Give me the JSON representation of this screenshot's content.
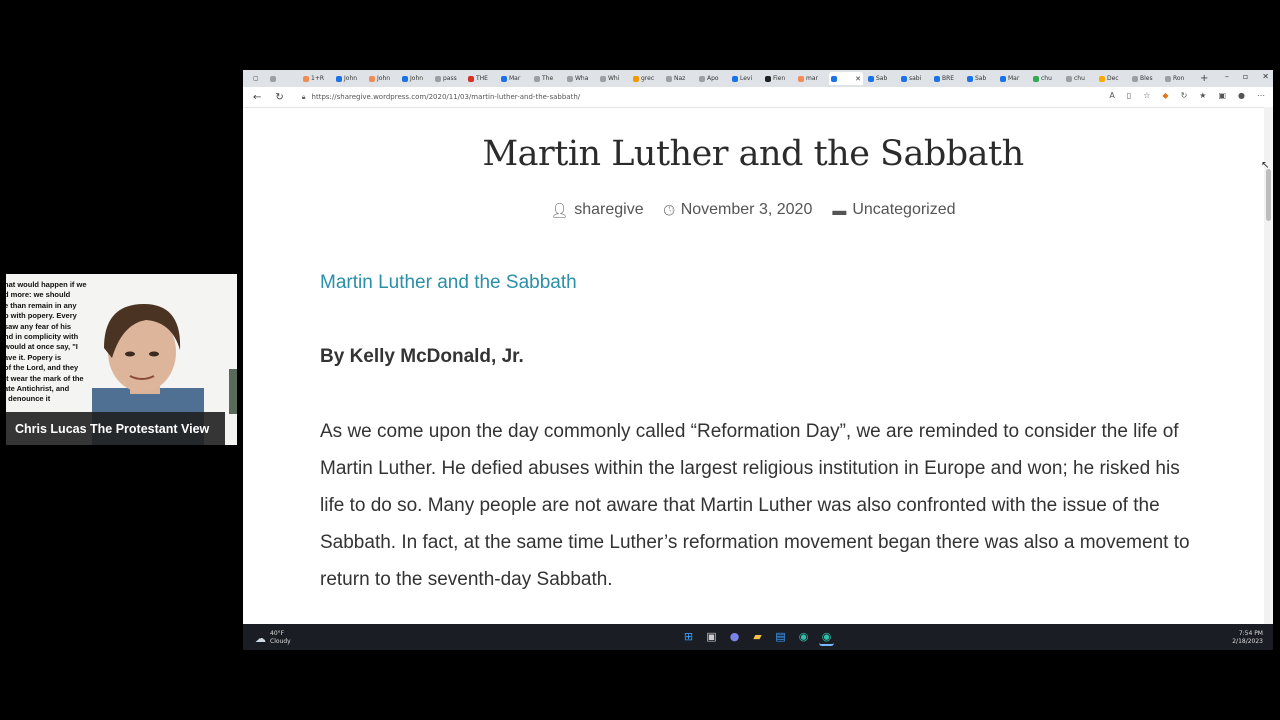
{
  "browser": {
    "tabs": [
      {
        "label": "",
        "color": "#9aa0a6"
      },
      {
        "label": "1+R",
        "color": "#f28b54"
      },
      {
        "label": "John",
        "color": "#1a73e8"
      },
      {
        "label": "John",
        "color": "#f28b54"
      },
      {
        "label": "John",
        "color": "#1a73e8"
      },
      {
        "label": "pass",
        "color": "#9aa0a6"
      },
      {
        "label": "THE",
        "color": "#d93025"
      },
      {
        "label": "Mar",
        "color": "#1a73e8"
      },
      {
        "label": "The",
        "color": "#9aa0a6"
      },
      {
        "label": "Wha",
        "color": "#9aa0a6"
      },
      {
        "label": "Whi",
        "color": "#9aa0a6"
      },
      {
        "label": "grec",
        "color": "#f29900"
      },
      {
        "label": "Naz",
        "color": "#9aa0a6"
      },
      {
        "label": "Apo",
        "color": "#9aa0a6"
      },
      {
        "label": "Levi",
        "color": "#1a73e8"
      },
      {
        "label": "Fien",
        "color": "#202124"
      },
      {
        "label": "mar",
        "color": "#f28b54"
      },
      {
        "label": "",
        "color": "#1a73e8",
        "active": true
      },
      {
        "label": "Sab",
        "color": "#1a73e8"
      },
      {
        "label": "sabi",
        "color": "#1a73e8"
      },
      {
        "label": "BRE",
        "color": "#1a73e8"
      },
      {
        "label": "Sab",
        "color": "#1a73e8"
      },
      {
        "label": "Mar",
        "color": "#1a73e8"
      },
      {
        "label": "chu",
        "color": "#34a853"
      },
      {
        "label": "chu",
        "color": "#9aa0a6"
      },
      {
        "label": "Dec",
        "color": "#f9ab00"
      },
      {
        "label": "Bles",
        "color": "#9aa0a6"
      },
      {
        "label": "Ron",
        "color": "#9aa0a6"
      }
    ],
    "url": "https://sharegive.wordpress.com/2020/11/03/martin-luther-and-the-sabbath/"
  },
  "post": {
    "title": "Martin Luther and the Sabbath",
    "author": "sharegive",
    "date": "November 3, 2020",
    "category": "Uncategorized",
    "link_text": "Martin Luther and the Sabbath",
    "byline": "By Kelly McDonald, Jr.",
    "paragraph": "As we come upon the day commonly called “Reformation Day”, we are reminded to consider the life of Martin Luther. He defied abuses within the largest religious institution in Europe and won; he risked his life to do so. Many people are not aware that Martin Luther was also confronted with the issue of the Sabbath. In fact, at the same time Luther’s reformation movement began there was also a movement to return to the seventh-day Sabbath."
  },
  "taskbar": {
    "temperature": "40°F",
    "weather": "Cloudy",
    "time": "7:54 PM",
    "date": "2/18/2023"
  },
  "webcam": {
    "name": "Chris Lucas The Protestant View",
    "background_text": [
      "hat would happen if we",
      "d more: we should",
      "e than remain in any",
      "p with popery. Every",
      "saw any fear of his",
      "nd in complicity with",
      "would at once say, \"I",
      "ave it. Popery is",
      "of the Lord, and they",
      "it wear the mark of the",
      "ate Antichrist, and",
      "I denounce it"
    ]
  }
}
